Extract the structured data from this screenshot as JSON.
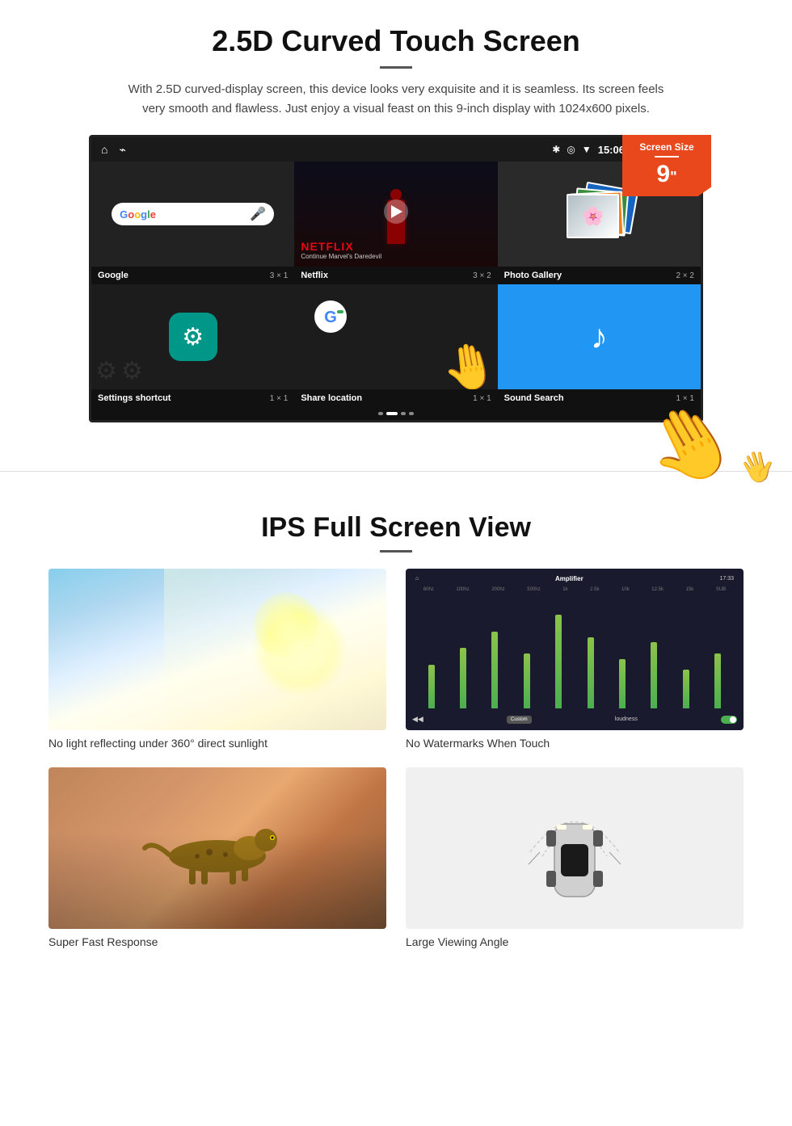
{
  "section1": {
    "title": "2.5D Curved Touch Screen",
    "description": "With 2.5D curved-display screen, this device looks very exquisite and it is seamless. Its screen feels very smooth and flawless. Just enjoy a visual feast on this 9-inch display with 1024x600 pixels.",
    "badge": {
      "label": "Screen Size",
      "size": "9",
      "unit": "\""
    },
    "statusBar": {
      "time": "15:06"
    },
    "apps": [
      {
        "name": "Google",
        "size": "3 × 1"
      },
      {
        "name": "Netflix",
        "size": "3 × 2"
      },
      {
        "name": "Photo Gallery",
        "size": "2 × 2"
      },
      {
        "name": "Settings shortcut",
        "size": "1 × 1"
      },
      {
        "name": "Share location",
        "size": "1 × 1"
      },
      {
        "name": "Sound Search",
        "size": "1 × 1"
      }
    ],
    "netflix": {
      "logo": "NETFLIX",
      "subtitle": "Continue Marvel's Daredevil"
    }
  },
  "section2": {
    "title": "IPS Full Screen View",
    "features": [
      {
        "id": "sunlight",
        "label": "No light reflecting under 360° direct sunlight"
      },
      {
        "id": "equalizer",
        "label": "No Watermarks When Touch"
      },
      {
        "id": "cheetah",
        "label": "Super Fast Response"
      },
      {
        "id": "car",
        "label": "Large Viewing Angle"
      }
    ]
  }
}
